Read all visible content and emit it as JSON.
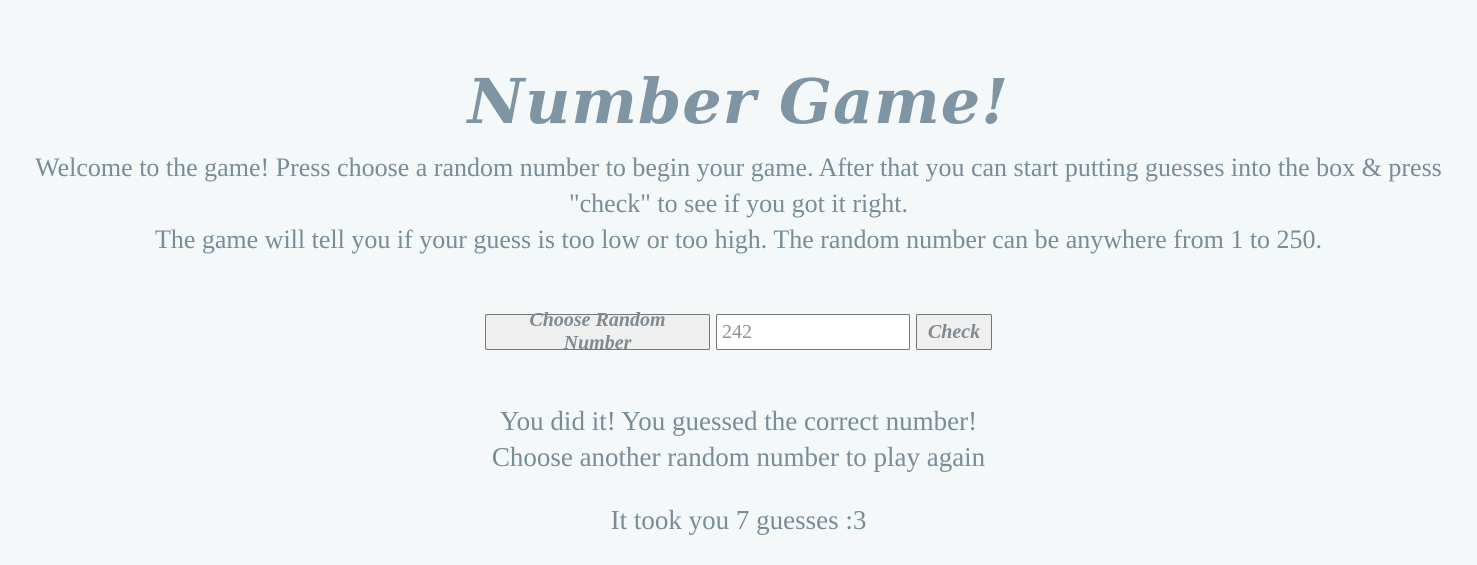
{
  "header": {
    "title": "Number Game!"
  },
  "intro": {
    "line1": "Welcome to the game! Press choose a random number to begin your game. After that you can start putting guesses into the box & press",
    "line2": "\"check\" to see if you got it right.",
    "line3": "The game will tell you if your guess is too low or too high. The random number can be anywhere from 1 to 250."
  },
  "controls": {
    "choose_label": "Choose Random Number",
    "guess_value": "242",
    "check_label": "Check"
  },
  "result": {
    "success": "You did it! You guessed the correct number!",
    "prompt": "Choose another random number to play again",
    "guess_count_text": "It took you 7 guesses :3"
  },
  "colors": {
    "background": "#f4f8f9",
    "text": "#798d99",
    "title": "#7f95a3",
    "button_bg": "#efefef"
  }
}
